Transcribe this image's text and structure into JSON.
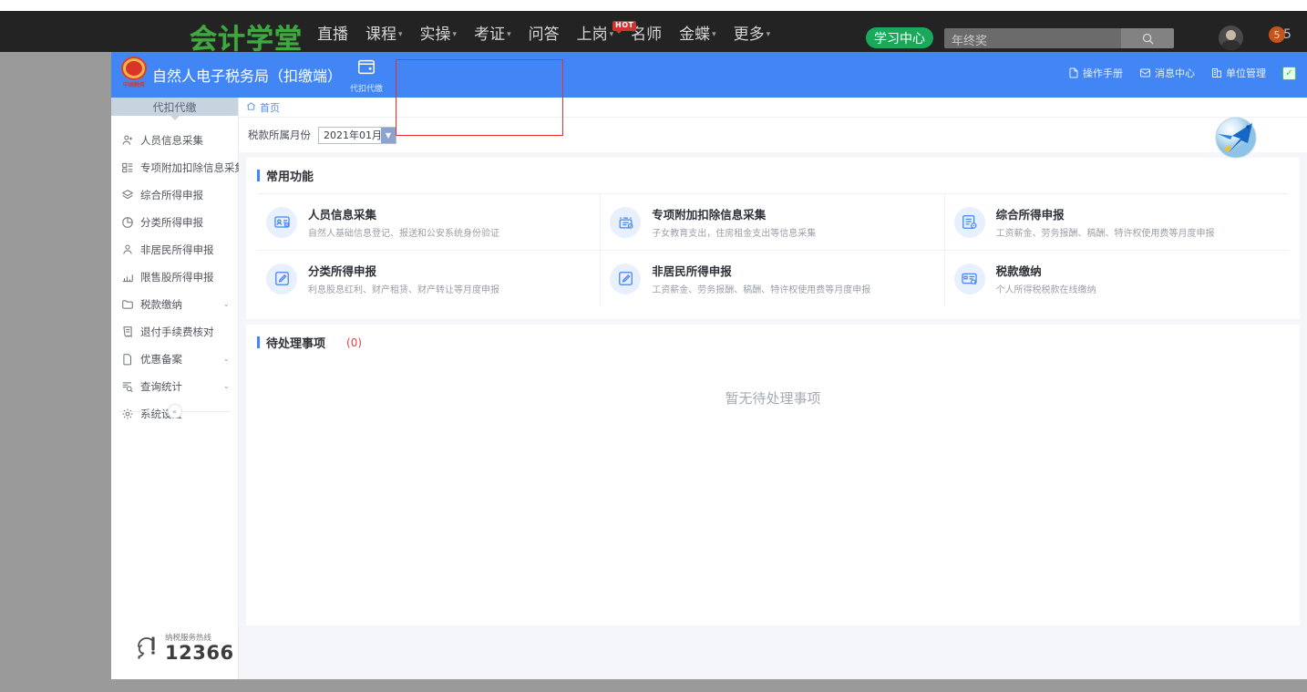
{
  "browser_topnav": {
    "brand": "会计学堂",
    "nav_items": [
      {
        "label": "直播",
        "caret": false
      },
      {
        "label": "课程",
        "caret": true
      },
      {
        "label": "实操",
        "caret": true
      },
      {
        "label": "考证",
        "caret": true
      },
      {
        "label": "问答",
        "caret": false
      },
      {
        "label": "上岗",
        "caret": true
      },
      {
        "label": "名师",
        "caret": false
      },
      {
        "label": "金蝶",
        "caret": true
      },
      {
        "label": "更多",
        "caret": true
      }
    ],
    "hot_badge": "HOT",
    "study_center": "学习中心",
    "search_value": "年终奖",
    "search_icon": "search-icon",
    "notification_count": "5",
    "notification_badge": "5"
  },
  "app_header": {
    "title": "自然人电子税务局（扣缴端）",
    "mode_label": "代扣代缴",
    "mode_icon": "wallet-icon",
    "right_items": [
      {
        "label": "操作手册",
        "icon": "document-icon"
      },
      {
        "label": "消息中心",
        "icon": "envelope-icon"
      },
      {
        "label": "单位管理",
        "icon": "building-icon"
      }
    ],
    "status_check": "✓",
    "emblem_text": "中国税务"
  },
  "sidebar": {
    "header": "代扣代缴",
    "items": [
      {
        "label": "人员信息采集",
        "icon": "person-add-icon",
        "expandable": false
      },
      {
        "label": "专项附加扣除信息采集",
        "icon": "list-detail-icon",
        "expandable": false
      },
      {
        "label": "综合所得申报",
        "icon": "layers-icon",
        "expandable": false
      },
      {
        "label": "分类所得申报",
        "icon": "pie-chart-icon",
        "expandable": false
      },
      {
        "label": "非居民所得申报",
        "icon": "user-icon",
        "expandable": false
      },
      {
        "label": "限售股所得申报",
        "icon": "bar-chart-icon",
        "expandable": false
      },
      {
        "label": "税款缴纳",
        "icon": "folder-icon",
        "expandable": true
      },
      {
        "label": "退付手续费核对",
        "icon": "receipt-icon",
        "expandable": false
      },
      {
        "label": "优惠备案",
        "icon": "file-icon",
        "expandable": true
      },
      {
        "label": "查询统计",
        "icon": "search-list-icon",
        "expandable": true
      },
      {
        "label": "系统设置",
        "icon": "gear-icon",
        "expandable": false
      }
    ],
    "collapse_icon": "chevron-left-double-icon",
    "hotline": {
      "label": "纳税服务热线",
      "number": "12366",
      "icon": "headset-icon"
    }
  },
  "main": {
    "breadcrumb": {
      "icon": "home-icon",
      "text": "首页"
    },
    "filter": {
      "label": "税款所属月份",
      "value": "2021年01月",
      "arrow_icon": "chevron-down-icon"
    },
    "bird_icon": "swallow-logo",
    "common_functions": {
      "title": "常用功能",
      "cards": [
        {
          "title": "人员信息采集",
          "desc": "自然人基础信息登记、报送和公安系统身份验证",
          "icon": "id-card-icon"
        },
        {
          "title": "专项附加扣除信息采集",
          "desc": "子女教育支出，住房租金支出等信息采集",
          "icon": "deduction-form-icon"
        },
        {
          "title": "综合所得申报",
          "desc": "工资薪金、劳务报酬、稿酬、特许权使用费等月度申报",
          "icon": "report-icon"
        },
        {
          "title": "分类所得申报",
          "desc": "利息股息红利、财产租赁、财产转让等月度申报",
          "icon": "edit-icon"
        },
        {
          "title": "非居民所得申报",
          "desc": "工资薪金、劳务报酬、稿酬、特许权使用费等月度申报",
          "icon": "edit-icon"
        },
        {
          "title": "税款缴纳",
          "desc": "个人所得税税款在线缴纳",
          "icon": "payment-card-icon"
        }
      ]
    },
    "todo": {
      "title": "待处理事项",
      "count": "(0)",
      "empty_text": "暂无待处理事项"
    }
  }
}
